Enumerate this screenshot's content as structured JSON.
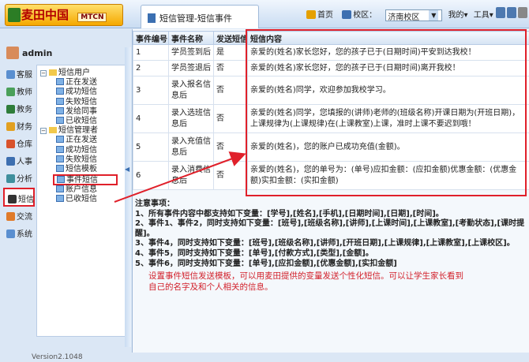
{
  "header": {
    "logo_text": "麦田中国",
    "logo_badge": "MTCN",
    "tab_title": "短信管理-短信事件",
    "home_label": "首页",
    "campus_label": "校区：",
    "campus_value": "济南校区",
    "my_label": "我的▾",
    "tools_label": "工具▾"
  },
  "user": {
    "name": "admin"
  },
  "nav": [
    {
      "label": "客服",
      "icon": "customer-service-icon",
      "color": "#5a8fd0"
    },
    {
      "label": "教师",
      "icon": "teacher-icon",
      "color": "#4aa05a"
    },
    {
      "label": "教务",
      "icon": "academic-icon",
      "color": "#2f7d3a"
    },
    {
      "label": "财务",
      "icon": "finance-icon",
      "color": "#e2a020"
    },
    {
      "label": "仓库",
      "icon": "warehouse-icon",
      "color": "#d9532c"
    },
    {
      "label": "人事",
      "icon": "hr-icon",
      "color": "#3d6fb0"
    },
    {
      "label": "分析",
      "icon": "analysis-icon",
      "color": "#3f8f9d"
    },
    {
      "label": "短信",
      "icon": "sms-icon",
      "color": "#333333"
    },
    {
      "label": "交流",
      "icon": "chat-icon",
      "color": "#e07b2a"
    },
    {
      "label": "系统",
      "icon": "system-icon",
      "color": "#5a8fd0"
    }
  ],
  "tree": {
    "group1": "短信用户",
    "group1_items": [
      "正在发送",
      "成功短信",
      "失败短信",
      "发给同事",
      "已收短信"
    ],
    "group2": "短信管理者",
    "group2_items": [
      "正在发送",
      "成功短信",
      "失败短信",
      "短信模板",
      "事件短信",
      "账户信息",
      "已收短信"
    ]
  },
  "version": "Version2.1048",
  "table": {
    "headers": [
      "事件编号",
      "事件名称",
      "发送短信",
      "短信内容"
    ],
    "rows": [
      [
        "1",
        "学员签到后",
        "是",
        "亲爱的(姓名)家长您好，您的孩子已于(日期时间)平安到达我校！"
      ],
      [
        "2",
        "学员签退后",
        "否",
        "亲爱的(姓名)家长您好，您的孩子已于(日期时间)离开我校！"
      ],
      [
        "3",
        "录入报名信息后",
        "否",
        "亲爱的(姓名)同学，欢迎参加我校学习。"
      ],
      [
        "4",
        "录入选班信息后",
        "否",
        "亲爱的(姓名)同学，您填报的(讲师)老师的(班级名称)开课日期为(开班日期)，上课规律为(上课规律)在(上课教室)上课，准时上课不要迟到哦！"
      ],
      [
        "5",
        "录入充值信息后",
        "否",
        "亲爱的(姓名)，您的账户已成功充值(金额)。"
      ],
      [
        "6",
        "录入消费信息后",
        "否",
        "亲爱的(姓名)，您的单号为：(单号)应扣金额：(应扣金额)优惠金额：(优惠金额)实扣金额：(实扣金额)"
      ]
    ]
  },
  "notes": {
    "title": "注意事项：",
    "lines": [
      "1、所有事件内容中都支持如下变量：[学号],[姓名],[手机],[日期时间],[日期],[时间]。",
      "2、事件1、事件2，同时支持如下变量：[班号],[班级名称],[讲师],[上课时间],[上课教室],[考勤状态],[课时提醒]。",
      "3、事件4，同时支持如下变量：[班号],[班级名称],[讲师],[开班日期],[上课规律],[上课教室],[上课校区]。",
      "4、事件5，同时支持如下变量：[单号],[付款方式],[类型],[金额]。",
      "5、事件6，同时支持如下变量：[单号],[应扣金额],[优惠金额],[实扣金额]"
    ]
  },
  "description": "设置事件短信发送模板，可以用麦田提供的变量发送个性化短信。可以让学生家长看到自己的名字及和个人相关的信息。"
}
